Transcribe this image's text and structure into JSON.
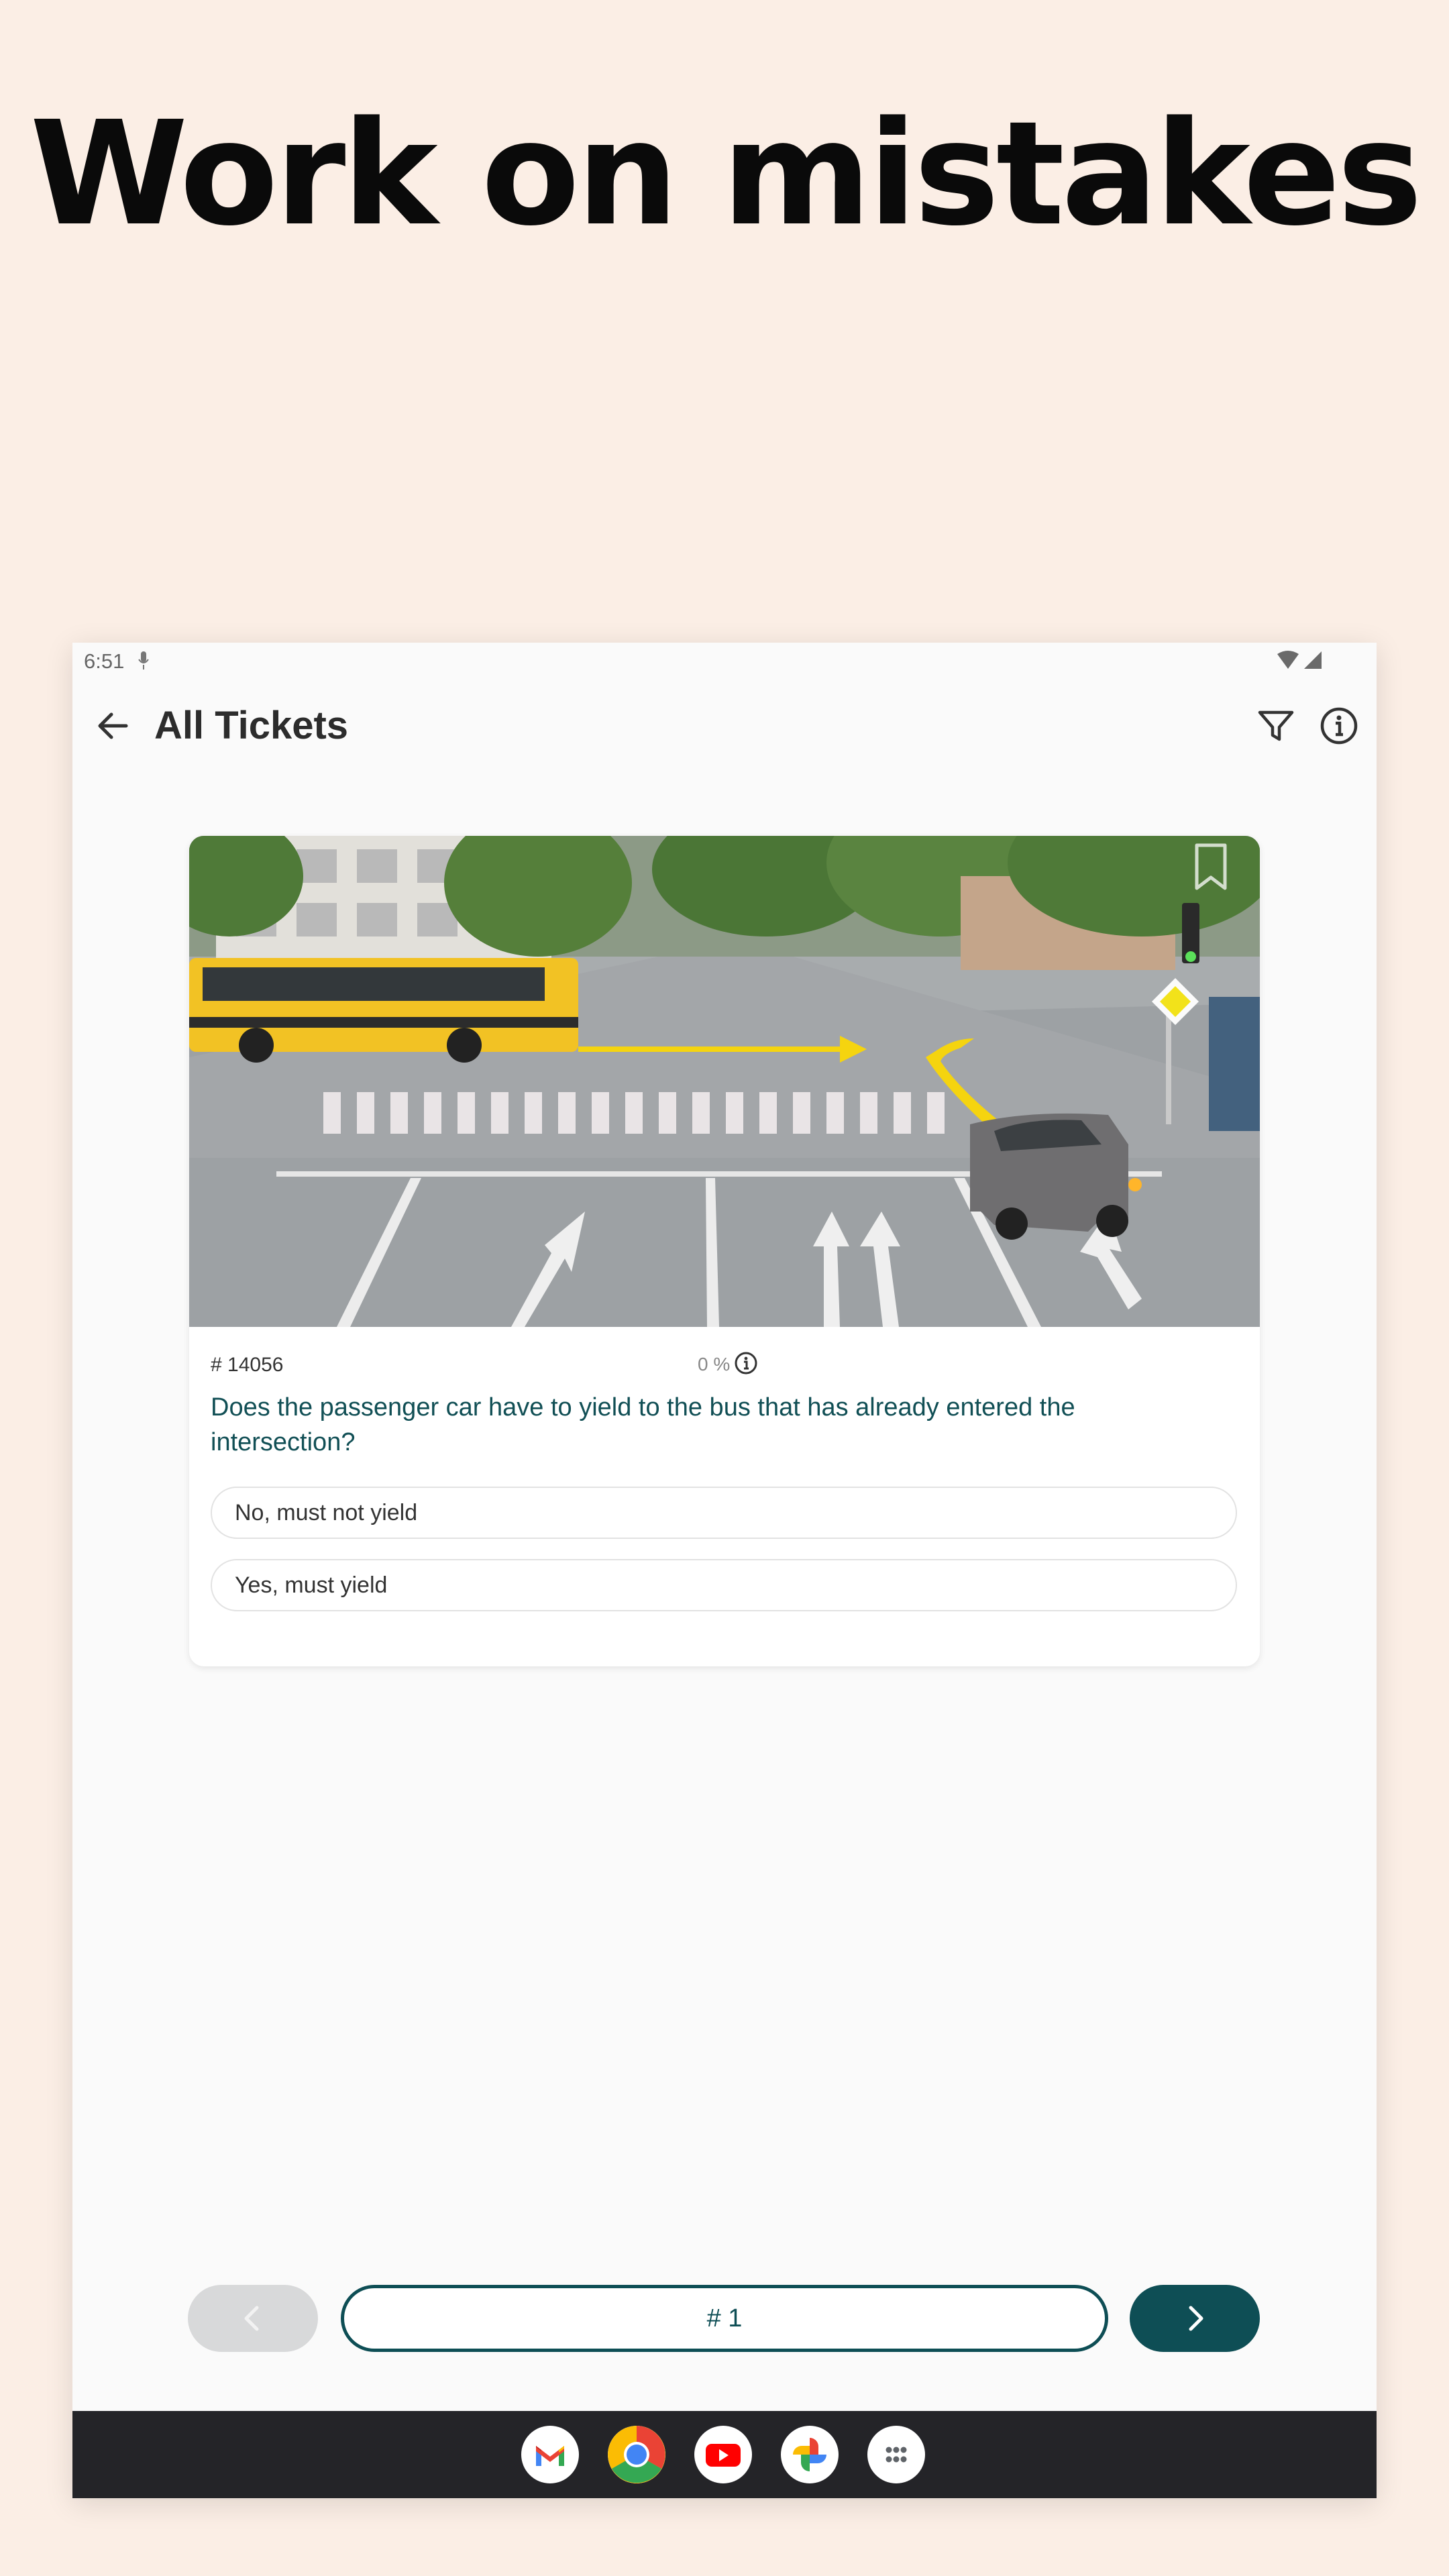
{
  "headline": "Work on mistakes",
  "status_bar": {
    "time": "6:51"
  },
  "app_bar": {
    "title": "All Tickets"
  },
  "question": {
    "id_label": "# 14056",
    "percent_label": "0 %",
    "text": "Does the passenger car have to yield to the bus that has already entered the intersection?",
    "answers": [
      {
        "label": "No, must not yield"
      },
      {
        "label": "Yes, must yield"
      }
    ]
  },
  "navigation": {
    "page_label": "# 1"
  },
  "colors": {
    "accent": "#0e4e55",
    "background": "#fbeee5",
    "question_text": "#114f55"
  },
  "dock": {
    "apps": [
      "gmail-icon",
      "chrome-icon",
      "youtube-icon",
      "photos-icon",
      "app-drawer-icon"
    ]
  }
}
